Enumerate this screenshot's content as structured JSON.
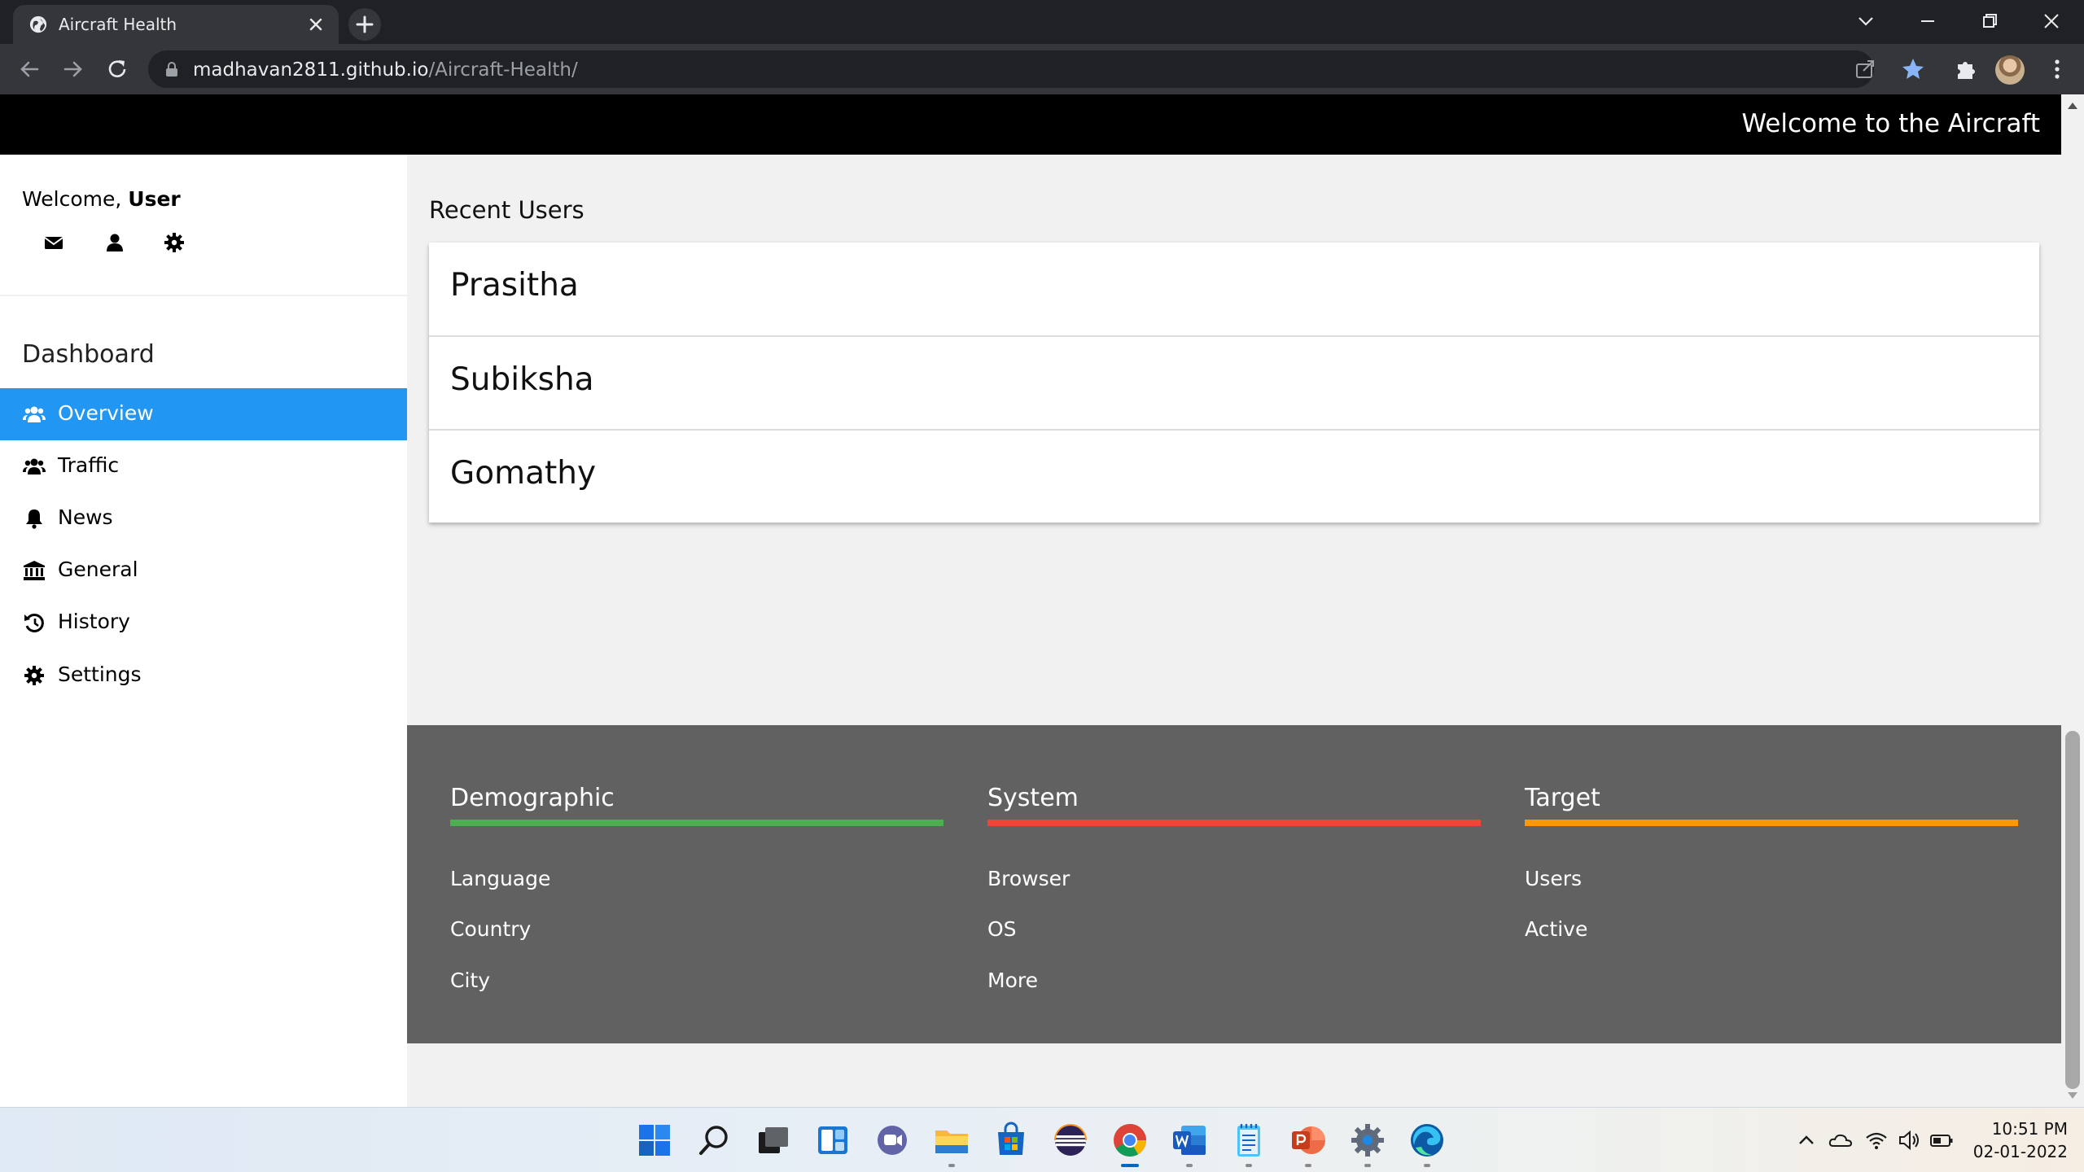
{
  "browser": {
    "tab_title": "Aircraft Health",
    "url_host": "madhavan2811.github.io",
    "url_path": "/Aircraft-Health/"
  },
  "header": {
    "welcome_banner": "Welcome to the Aircraft"
  },
  "sidebar": {
    "welcome_prefix": "Welcome,",
    "user_name": "User",
    "quick_icons": [
      "envelope-icon",
      "user-icon",
      "gear-icon"
    ],
    "dashboard_title": "Dashboard",
    "items": [
      {
        "label": "Overview",
        "icon": "users-icon",
        "active": true
      },
      {
        "label": "Traffic",
        "icon": "users-icon",
        "active": false
      },
      {
        "label": "News",
        "icon": "bell-icon",
        "active": false
      },
      {
        "label": "General",
        "icon": "bank-icon",
        "active": false
      },
      {
        "label": "History",
        "icon": "history-icon",
        "active": false
      },
      {
        "label": "Settings",
        "icon": "gear-icon",
        "active": false
      }
    ]
  },
  "main": {
    "recent_users_title": "Recent Users",
    "recent_users": [
      "Prasitha",
      "Subiksha",
      "Gomathy"
    ]
  },
  "footer": {
    "columns": [
      {
        "title": "Demographic",
        "color": "#4caf50",
        "links": [
          "Language",
          "Country",
          "City"
        ]
      },
      {
        "title": "System",
        "color": "#f44336",
        "links": [
          "Browser",
          "OS",
          "More"
        ]
      },
      {
        "title": "Target",
        "color": "#ff9800",
        "links": [
          "Users",
          "Active"
        ]
      }
    ]
  },
  "colors": {
    "accent": "#2196f3",
    "topbar": "#000000",
    "footer_bg": "#616161"
  },
  "taskbar": {
    "apps": [
      "windows-start-icon",
      "search-icon",
      "task-view-icon",
      "widgets-icon",
      "teams-chat-icon",
      "file-explorer-icon",
      "microsoft-store-icon",
      "eclipse-icon",
      "chrome-icon",
      "word-icon",
      "notepad-icon",
      "powerpoint-icon",
      "settings-icon",
      "edge-icon"
    ],
    "time": "10:51 PM",
    "date": "02-01-2022"
  }
}
